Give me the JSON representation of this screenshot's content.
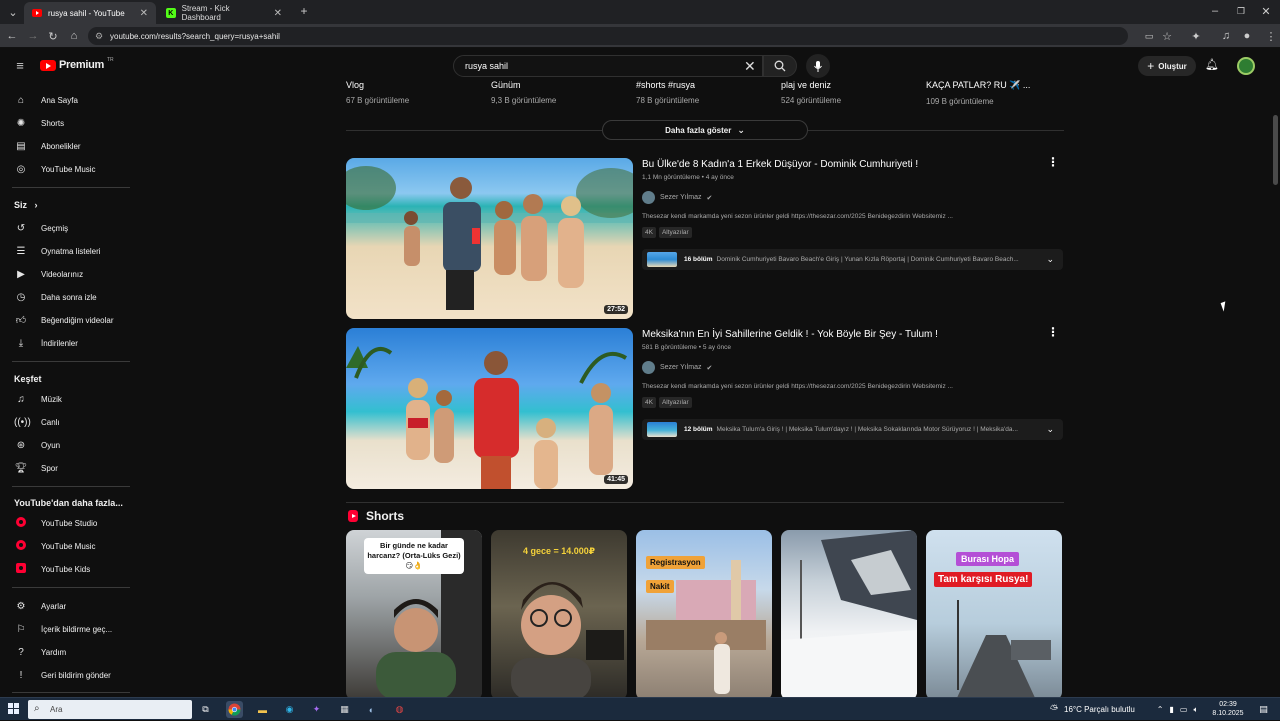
{
  "browser": {
    "tabs": [
      {
        "title": "rusya sahil - YouTube",
        "active": true
      },
      {
        "title": "Stream - Kick Dashboard",
        "active": false
      }
    ],
    "url": "youtube.com/results?search_query=rusya+sahil"
  },
  "masthead": {
    "brand": "Premium",
    "brand_sup": "TR",
    "search_value": "rusya sahil",
    "create_label": "Oluştur"
  },
  "sidebar": {
    "main": [
      {
        "label": "Ana Sayfa",
        "icon": "home-icon"
      },
      {
        "label": "Shorts",
        "icon": "shorts-icon"
      },
      {
        "label": "Abonelikler",
        "icon": "subscriptions-icon"
      },
      {
        "label": "YouTube Music",
        "icon": "music-disc-icon"
      }
    ],
    "you_head": "Siz",
    "you": [
      {
        "label": "Geçmiş",
        "icon": "history-icon"
      },
      {
        "label": "Oynatma listeleri",
        "icon": "playlists-icon"
      },
      {
        "label": "Videolarınız",
        "icon": "your-videos-icon"
      },
      {
        "label": "Daha sonra izle",
        "icon": "watch-later-icon"
      },
      {
        "label": "Beğendiğim videolar",
        "icon": "like-icon"
      },
      {
        "label": "İndirilenler",
        "icon": "download-icon"
      }
    ],
    "explore_head": "Keşfet",
    "explore": [
      {
        "label": "Müzik",
        "icon": "music-note-icon"
      },
      {
        "label": "Canlı",
        "icon": "live-icon"
      },
      {
        "label": "Oyun",
        "icon": "gaming-icon"
      },
      {
        "label": "Spor",
        "icon": "trophy-icon"
      }
    ],
    "more_head": "YouTube'dan daha fazla...",
    "more": [
      {
        "label": "YouTube Studio",
        "icon": "youtube-studio-icon"
      },
      {
        "label": "YouTube Music",
        "icon": "youtube-music-icon"
      },
      {
        "label": "YouTube Kids",
        "icon": "youtube-kids-icon"
      }
    ],
    "settings": [
      {
        "label": "Ayarlar",
        "icon": "settings-icon"
      },
      {
        "label": "İçerik bildirme geç...",
        "icon": "flag-icon"
      },
      {
        "label": "Yardım",
        "icon": "help-icon"
      },
      {
        "label": "Geri bildirim gönder",
        "icon": "feedback-icon"
      }
    ]
  },
  "top_row": [
    {
      "title": "Vlog",
      "views": "67 B görüntüleme"
    },
    {
      "title": "Günüm",
      "views": "9,3 B görüntüleme"
    },
    {
      "title": "#shorts #rusya",
      "views": "78 B görüntüleme"
    },
    {
      "title": "plaj ve deniz",
      "views": "524 görüntüleme"
    },
    {
      "title": "KAÇA PATLAR? RU ✈️ ...",
      "views": "109 B görüntüleme"
    }
  ],
  "more_button": "Daha fazla göster",
  "videos": [
    {
      "title": "Bu Ülke'de 8 Kadın'a 1 Erkek Düşüyor - Dominik Cumhuriyeti !",
      "meta": "1,1 Mn görüntüleme • 4 ay önce",
      "channel": "Sezer Yılmaz",
      "description": "Thesezar kendi markamda yeni sezon ürünler geldi https://thesezar.com/2025 Benidegezdirin Websitemiz ...",
      "badges": [
        "4K",
        "Altyazılar"
      ],
      "duration": "27:52",
      "chapters_count": "16 bölüm",
      "chapters_text": "Dominik Cumhuriyeti Bavaro Beach'e Giriş | Yunan Kızla Röportaj | Dominik Cumhuriyeti Bavaro Beach..."
    },
    {
      "title": "Meksika'nın En İyi Sahillerine Geldik ! - Yok Böyle Bir Şey - Tulum !",
      "meta": "581 B görüntüleme • 5 ay önce",
      "channel": "Sezer Yılmaz",
      "description": "Thesezar kendi markamda yeni sezon ürünler geldi https://thesezar.com/2025 Benidegezdirin Websitemiz ...",
      "badges": [
        "4K",
        "Altyazılar"
      ],
      "duration": "41:45",
      "chapters_count": "12 bölüm",
      "chapters_text": "Meksika Tulum'a Giriş ! | Meksika Tulum'dayız ! | Meksika Sokaklarında Motor Sürüyoruz ! | Meksika'da..."
    }
  ],
  "shorts": {
    "heading": "Shorts",
    "items": [
      {
        "label": "Bir günde ne kadar harcanz? (Orta-Lüks Gezi) 😏👌"
      },
      {
        "label": "4 gece = 14.000₽"
      },
      {
        "label": "Registrasyon",
        "label2": "Nakit"
      },
      {
        "label": ""
      },
      {
        "label": "Burası Hopa",
        "label2": "Tam karşısı Rusya!"
      }
    ]
  },
  "taskbar": {
    "search_placeholder": "Ara",
    "weather": "16°C  Parçalı bulutlu",
    "time": "02:39",
    "date": "8.10.2025"
  }
}
